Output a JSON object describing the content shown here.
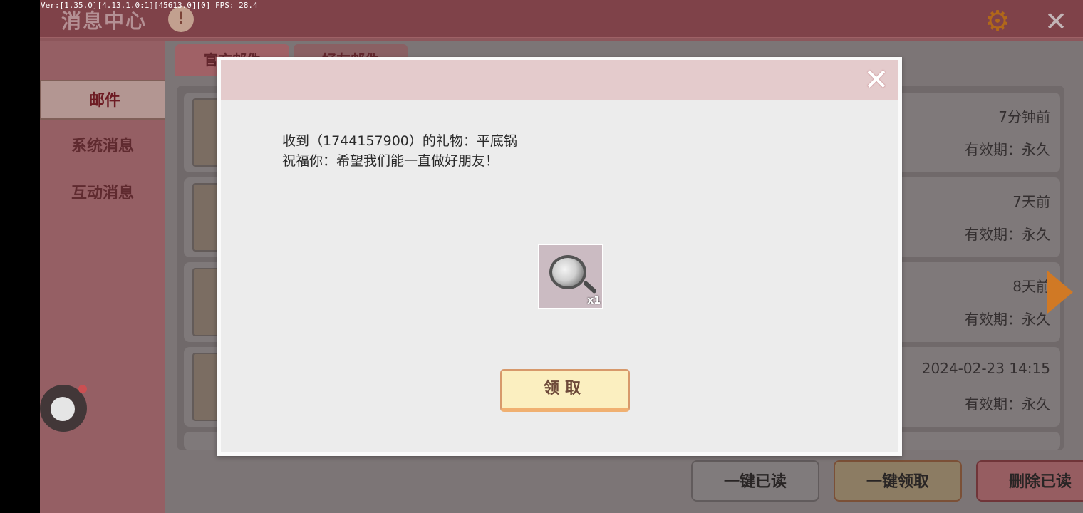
{
  "debug": "Ver:[1.35.0][4.13.1.0:1][45613.0][0] FPS: 28.4",
  "header": {
    "title": "消息中心",
    "badge": "!"
  },
  "sidebar": {
    "items": [
      "邮件",
      "系统消息",
      "互动消息"
    ]
  },
  "tabs": [
    "官方邮件",
    "好友邮件"
  ],
  "mails": [
    {
      "time": "7分钟前",
      "validity": "有效期：永久"
    },
    {
      "time": "7天前",
      "validity": "有效期：永久"
    },
    {
      "time": "8天前",
      "validity": "有效期：永久"
    },
    {
      "time": "2024-02-23 14:15",
      "validity": "有效期：永久"
    }
  ],
  "bottom_buttons": {
    "read_all": "一键已读",
    "claim_all": "一键领取",
    "delete_read": "删除已读"
  },
  "dialog": {
    "line1": "收到（1744157900）的礼物：平底锅",
    "line2": "祝福你：希望我们能一直做好朋友！",
    "item_qty": "x1",
    "claim_label": "领取"
  }
}
